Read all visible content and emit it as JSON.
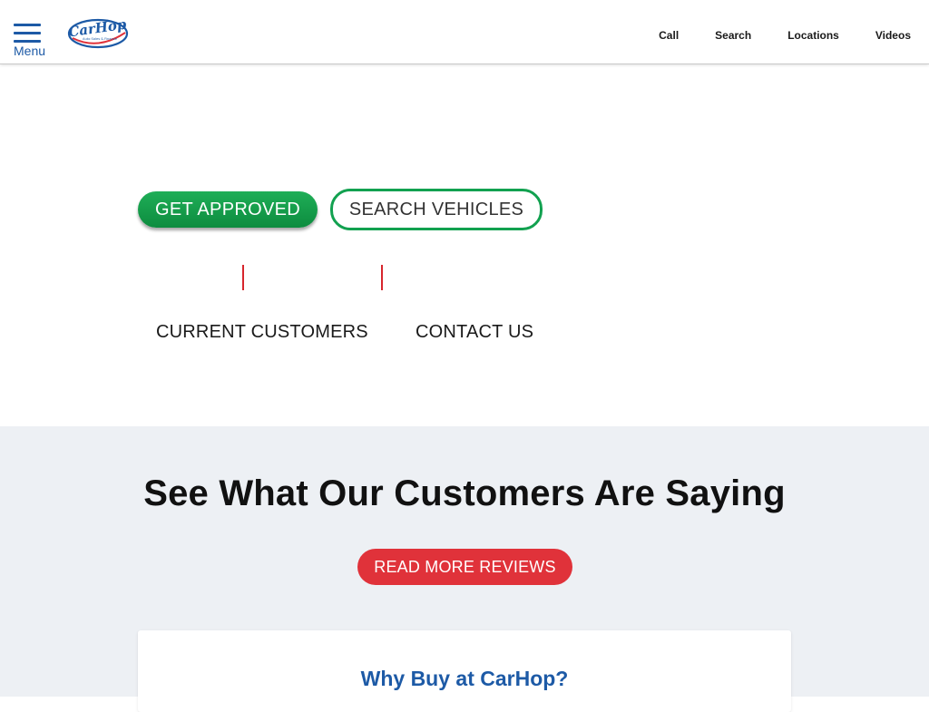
{
  "header": {
    "menu_label": "Menu",
    "logo": {
      "brand": "CarHop",
      "tagline": "Auto Sales & Finance",
      "colors": {
        "primary": "#1d5aa6",
        "accent": "#e0323a"
      }
    },
    "nav": [
      {
        "label": "Call"
      },
      {
        "label": "Search"
      },
      {
        "label": "Locations"
      },
      {
        "label": "Videos"
      }
    ]
  },
  "hero": {
    "get_approved_label": "GET APPROVED",
    "search_vehicles_label": "SEARCH VEHICLES",
    "current_customers_label": "CURRENT CUSTOMERS",
    "contact_us_label": "CONTACT US"
  },
  "reviews": {
    "title": "See What Our Customers Are Saying",
    "button_label": "READ MORE REVIEWS"
  },
  "why": {
    "title": "Why Buy at CarHop?"
  },
  "colors": {
    "brand_blue": "#1d5aa6",
    "green": "#12a150",
    "red": "#e0323a",
    "section_bg": "#edf0f4"
  },
  "icons": {
    "menu": "hamburger-icon",
    "logo": "carhop-logo"
  }
}
